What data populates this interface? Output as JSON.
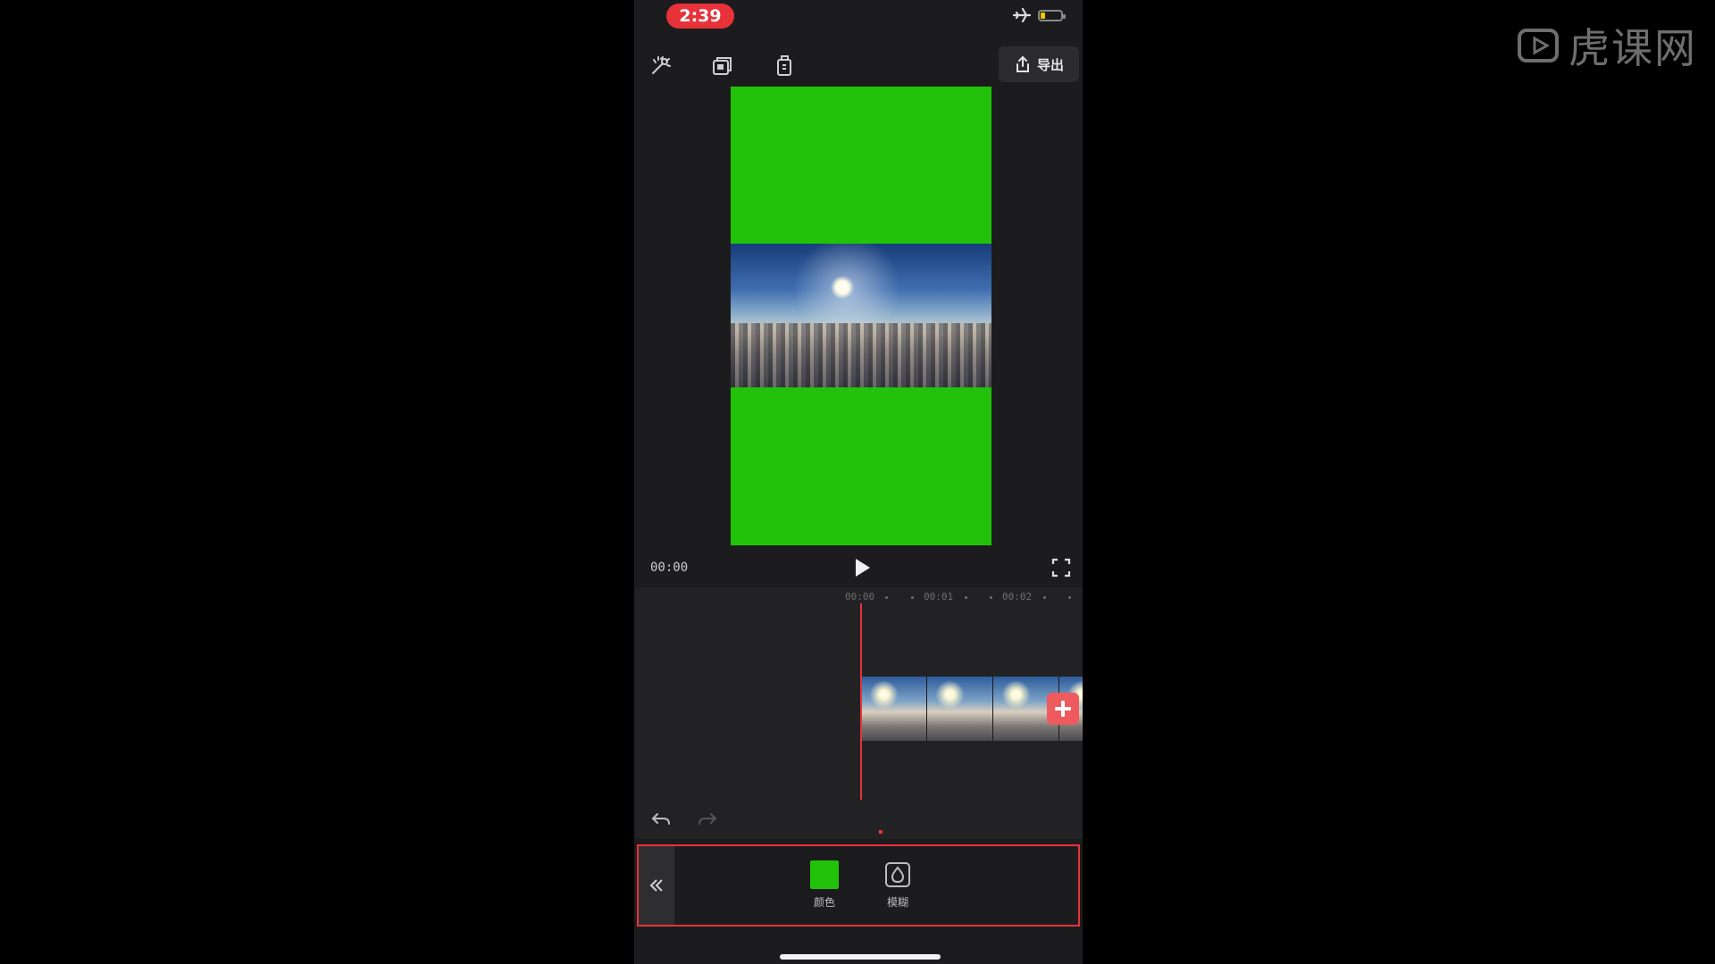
{
  "watermark": {
    "text": "虎课网"
  },
  "status_bar": {
    "time": "2:39"
  },
  "toolbar": {
    "export_label": "导出"
  },
  "player": {
    "timecode": "00:00"
  },
  "timeline": {
    "ruler": [
      "00:00",
      "00:01",
      "00:02"
    ]
  },
  "bottom_panel": {
    "tools": [
      {
        "label": "颜色",
        "icon": "green-color-swatch"
      },
      {
        "label": "模糊",
        "icon": "blur-icon"
      }
    ]
  },
  "colors": {
    "accent": "#e8323a",
    "green_screen": "#22c20a",
    "panel_bg": "#1c1c1e"
  }
}
